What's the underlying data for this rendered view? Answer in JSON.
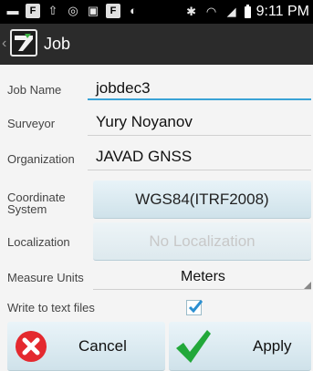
{
  "status_bar": {
    "time": "9:11 PM",
    "left_icons": [
      "message-icon",
      "flipboard-icon",
      "person-upload-icon",
      "alarm-icon",
      "image-icon",
      "flipboard-icon",
      "android-icon"
    ],
    "right_icons": [
      "bluetooth-icon",
      "wifi-icon",
      "signal-icon",
      "battery-icon"
    ]
  },
  "action_bar": {
    "title": "Job"
  },
  "form": {
    "job_name": {
      "label": "Job Name",
      "value": "jobdec3"
    },
    "surveyor": {
      "label": "Surveyor",
      "value": "Yury Noyanov"
    },
    "organization": {
      "label": "Organization",
      "value": "JAVAD GNSS"
    },
    "coordinate_system": {
      "label": "Coordinate System",
      "value": "WGS84(ITRF2008)"
    },
    "localization": {
      "label": "Localization",
      "value": "No Localization"
    },
    "measure_units": {
      "label": "Measure Units",
      "value": "Meters"
    },
    "write_to_text_files": {
      "label": "Write to text files",
      "checked": true
    }
  },
  "buttons": {
    "cancel": "Cancel",
    "apply": "Apply"
  },
  "colors": {
    "accent": "#3aa3d6",
    "cancel_red": "#e4292f",
    "apply_green": "#22a83a",
    "action_bar": "#2b2b2b"
  }
}
